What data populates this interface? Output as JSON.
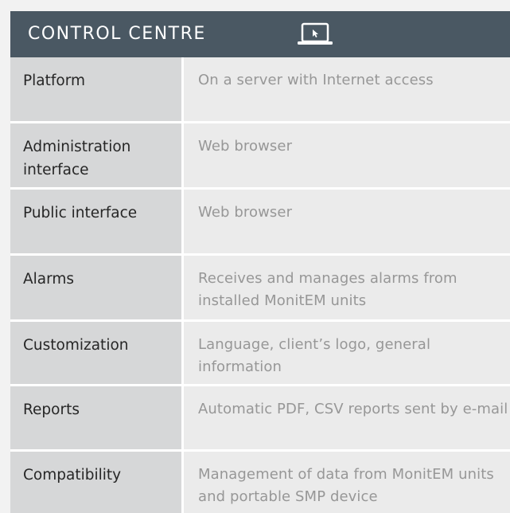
{
  "header": {
    "title": "CONTROL CENTRE",
    "icon": "laptop-icon",
    "background": "#4a5863"
  },
  "rows": [
    {
      "label": "Platform",
      "value": "On  a server with Internet access"
    },
    {
      "label": "Administration interface",
      "value": "Web browser"
    },
    {
      "label": "Public interface",
      "value": "Web browser"
    },
    {
      "label": "Alarms",
      "value": "Receives and manages alarms from installed MonitEM units"
    },
    {
      "label": "Customization",
      "value": "Language, client’s logo, general information"
    },
    {
      "label": "Reports",
      "value": "Automatic PDF, CSV reports sent by e-mail"
    },
    {
      "label": "Compatibility",
      "value": "Management of data from MonitEM units and portable SMP device"
    }
  ],
  "colors": {
    "label_background": "#d6d7d8",
    "value_background": "#ebebeb",
    "value_text": "#979797",
    "label_text": "#262626"
  }
}
